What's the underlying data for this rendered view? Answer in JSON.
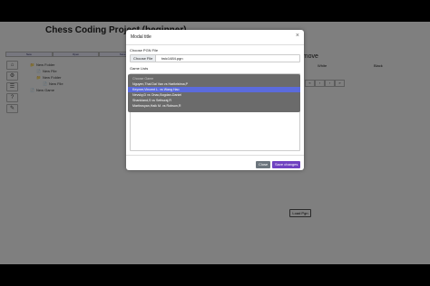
{
  "page": {
    "title": "Chess Coding Project (beginner)",
    "tabs": [
      "New",
      "Open",
      "Save"
    ],
    "tools": [
      "⌂",
      "⚙",
      "☰",
      "?",
      "✎"
    ],
    "tree": [
      {
        "icon": "📁",
        "label": "New Folder",
        "indent": 0
      },
      {
        "icon": "📄",
        "label": "New File",
        "indent": 1
      },
      {
        "icon": "📁",
        "label": "New Folder",
        "indent": 1
      },
      {
        "icon": "📄",
        "label": "New File",
        "indent": 2
      },
      {
        "icon": "📄",
        "label": "New Game",
        "indent": 0
      }
    ],
    "side_heading": "to move",
    "table_headers": [
      "White",
      "Black"
    ],
    "pager": [
      "«",
      "‹",
      "›",
      "»"
    ],
    "load_button": "Load Pgn"
  },
  "modal": {
    "title": "Modal title",
    "close_symbol": "×",
    "pgn_label": "Choose PGN File",
    "file_button": "Choose File",
    "file_name": "twic1484.pgn",
    "game_list_label": "Game Lists",
    "dropdown": [
      {
        "text": "Choose Game",
        "type": "placeholder"
      },
      {
        "text": "Nguyen,Thai Dai Van vs Harikrishna,P",
        "type": "normal"
      },
      {
        "text": "Keymer,Vincent L. vs Wang Hao",
        "type": "selected"
      },
      {
        "text": "Nevsky,D vs Onac,Bogdan-Daniel",
        "type": "normal"
      },
      {
        "text": "Shankland,S vs Sethuraj,R",
        "type": "normal"
      },
      {
        "text": "Martirosyan,Haik M. vs Robson,R",
        "type": "normal"
      }
    ],
    "close_button": "Close",
    "save_button": "Save changes"
  }
}
